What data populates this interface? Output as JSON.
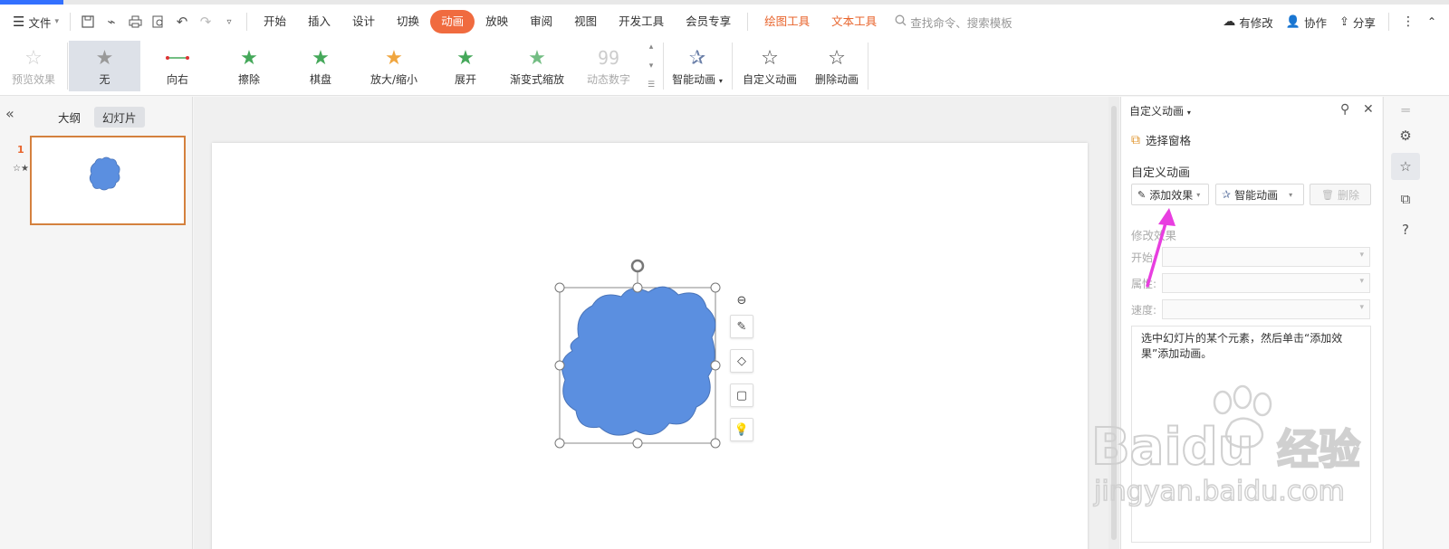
{
  "menubar": {
    "file": "文件",
    "tabs": [
      "开始",
      "插入",
      "设计",
      "切换",
      "动画",
      "放映",
      "审阅",
      "视图",
      "开发工具",
      "会员专享"
    ],
    "active_tab": "动画",
    "context_tabs": [
      "绘图工具",
      "文本工具"
    ],
    "search_placeholder": "查找命令、搜索模板",
    "status": "有修改",
    "collaborate": "协作",
    "share": "分享"
  },
  "ribbon": {
    "preview": "预览效果",
    "effects": [
      "无",
      "向右",
      "擦除",
      "棋盘",
      "放大/缩小",
      "展开",
      "渐变式缩放",
      "动态数字"
    ],
    "smart_animation": "智能动画",
    "custom_animation": "自定义动画",
    "delete_animation": "删除动画"
  },
  "leftpanel": {
    "tab_outline": "大纲",
    "tab_slides": "幻灯片",
    "slide_number": "1"
  },
  "rightpane": {
    "title": "自定义动画",
    "selection_pane": "选择窗格",
    "section_title": "自定义动画",
    "add_effect": "添加效果",
    "smart_animation": "智能动画",
    "delete": "删除",
    "modify_effect": "修改效果",
    "fields": [
      "开始:",
      "属性:",
      "速度:"
    ],
    "hint": "选中幻灯片的某个元素，然后单击“添加效果”添加动画。"
  },
  "colors": {
    "shape_fill": "#5b8fe0",
    "shape_stroke": "#4a74b8",
    "accent_orange": "#f06b3f",
    "arrow_magenta": "#e83ee0"
  },
  "watermark": {
    "brand": "Baidu",
    "cn": "经验",
    "url": "jingyan.baidu.com"
  }
}
